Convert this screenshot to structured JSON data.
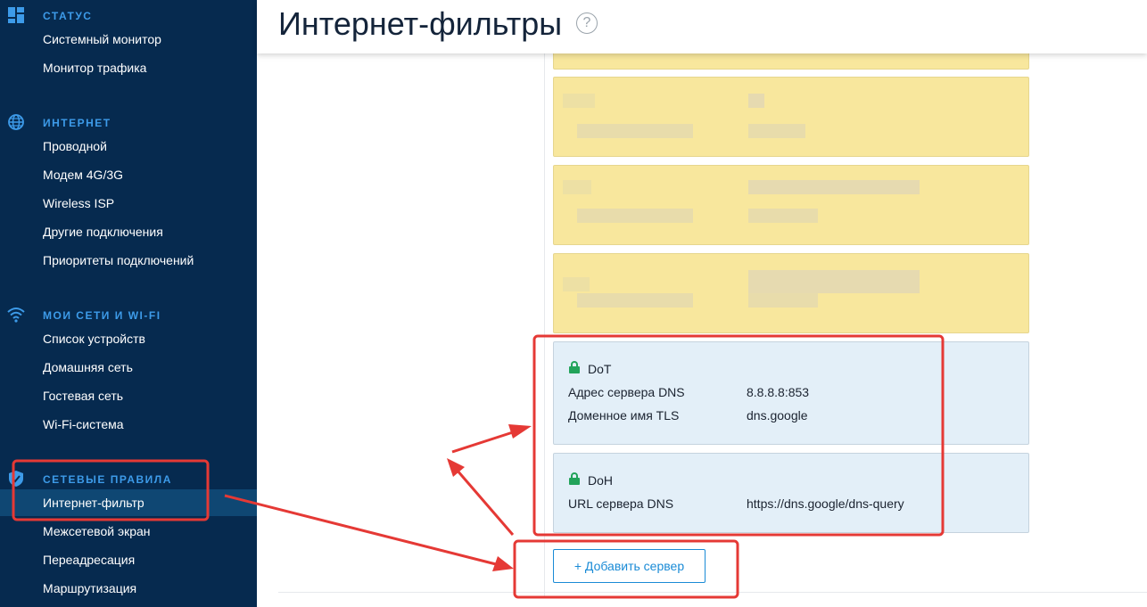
{
  "sidebar": {
    "sections": [
      {
        "icon": "dashboard-icon",
        "label": "СТАТУС",
        "items": [
          "Системный монитор",
          "Монитор трафика"
        ]
      },
      {
        "icon": "globe-icon",
        "label": "ИНТЕРНЕТ",
        "items": [
          "Проводной",
          "Модем 4G/3G",
          "Wireless ISP",
          "Другие подключения",
          "Приоритеты подключений"
        ]
      },
      {
        "icon": "wifi-icon",
        "label": "МОИ СЕТИ И WI-FI",
        "items": [
          "Список устройств",
          "Домашняя сеть",
          "Гостевая сеть",
          "Wi-Fi-система"
        ]
      },
      {
        "icon": "shield-icon",
        "label": "СЕТЕВЫЕ ПРАВИЛА",
        "items": [
          "Интернет-фильтр",
          "Межсетевой экран",
          "Переадресация",
          "Маршрутизация"
        ],
        "active": "Интернет-фильтр"
      }
    ]
  },
  "header": {
    "title": "Интернет-фильтры",
    "help": "?"
  },
  "servers": [
    {
      "type": "DoT",
      "rows": [
        {
          "label": "Адрес сервера DNS",
          "value": "8.8.8.8:853"
        },
        {
          "label": "Доменное имя TLS",
          "value": "dns.google"
        }
      ]
    },
    {
      "type": "DoH",
      "rows": [
        {
          "label": "URL сервера DNS",
          "value": "https://dns.google/dns-query"
        }
      ]
    }
  ],
  "add_server_label": "+ Добавить сервер",
  "colors": {
    "sidebar_bg": "#062a4f",
    "section_label": "#3d9be9",
    "redacted_card": "#f8e79d",
    "server_card": "#e3eff8",
    "lock": "#22a35a",
    "accent": "#1a8bd6",
    "annotation": "#e53935"
  }
}
